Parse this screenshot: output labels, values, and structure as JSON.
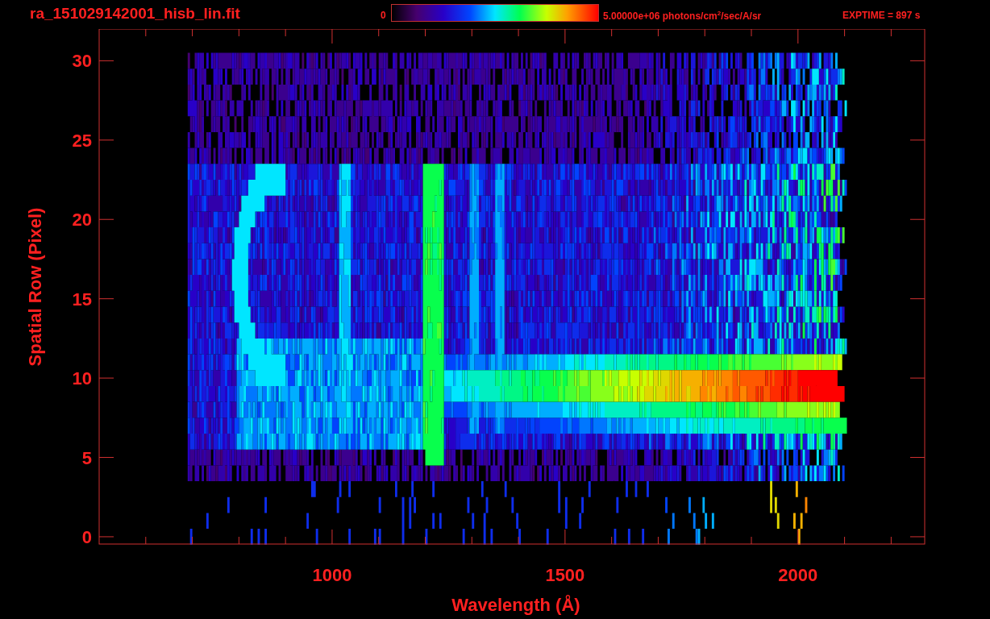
{
  "header": {
    "file_name": "ra_151029142001_hisb_lin.fit",
    "colorbar": {
      "min_label": "0",
      "max_label": "5.00000e+06 photons/cm$^{2}$/sec/A/sr"
    },
    "exposure": "EXPTIME = 897 s"
  },
  "plot": {
    "xlabel": "Wavelength (Å)",
    "ylabel": "Spatial Row (Pixel)",
    "xtick_labels": [
      "1000",
      "1500",
      "2000"
    ],
    "ytick_labels": [
      "30",
      "25",
      "20",
      "15",
      "10",
      "5",
      "0"
    ]
  }
}
